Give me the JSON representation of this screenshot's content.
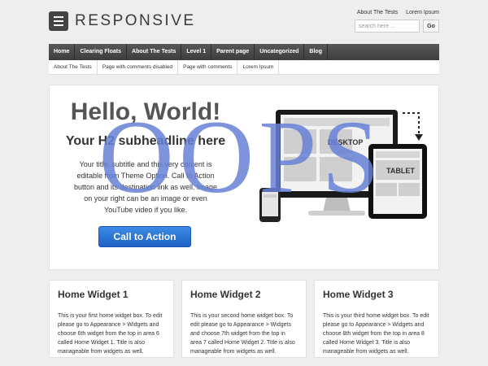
{
  "site": {
    "title": "RESPONSIVE"
  },
  "top_links": [
    "About The Tests",
    "Lorem Ipsum"
  ],
  "search": {
    "placeholder": "search here ...",
    "button": "Go"
  },
  "main_nav": [
    "Home",
    "Clearing Floats",
    "About The Tests",
    "Level 1",
    "Parent page",
    "Uncategorized",
    "Blog"
  ],
  "sub_nav": [
    "About The Tests",
    "Page with comments disabled",
    "Page with comments",
    "Lorem Ipsum"
  ],
  "hero": {
    "title": "Hello, World!",
    "subtitle": "Your H2 subheadline here",
    "text": "Your title, subtitle and this very content is editable from Theme Option. Call to Action button and its destination link as well. Image on your right can be an image or even YouTube video if you like.",
    "cta": "Call to Action",
    "device_labels": [
      "DESKTOP",
      "TABLET"
    ]
  },
  "overlay": {
    "text": "OOPS"
  },
  "widgets": [
    {
      "title": "Home Widget 1",
      "text": "This is your first home widget box. To edit please go to Appearance > Widgets and choose 6th widget from the top in area 6 called Home Widget 1. Title is also manageable from widgets as well."
    },
    {
      "title": "Home Widget 2",
      "text": "This is your second home widget box. To edit please go to Appearance > Widgets and choose 7th widget from the top in area 7 called Home Widget 2. Title is also manageable from widgets as well."
    },
    {
      "title": "Home Widget 3",
      "text": "This is your third home widget box. To edit please go to Appearance > Widgets and choose 8th widget from the top in area 8 called Home Widget 3. Title is also manageable from widgets as well."
    }
  ],
  "icons": [
    "menu-icon",
    "desktop-device-icon",
    "tablet-device-icon",
    "phone-device-icon",
    "arrow-icon"
  ]
}
